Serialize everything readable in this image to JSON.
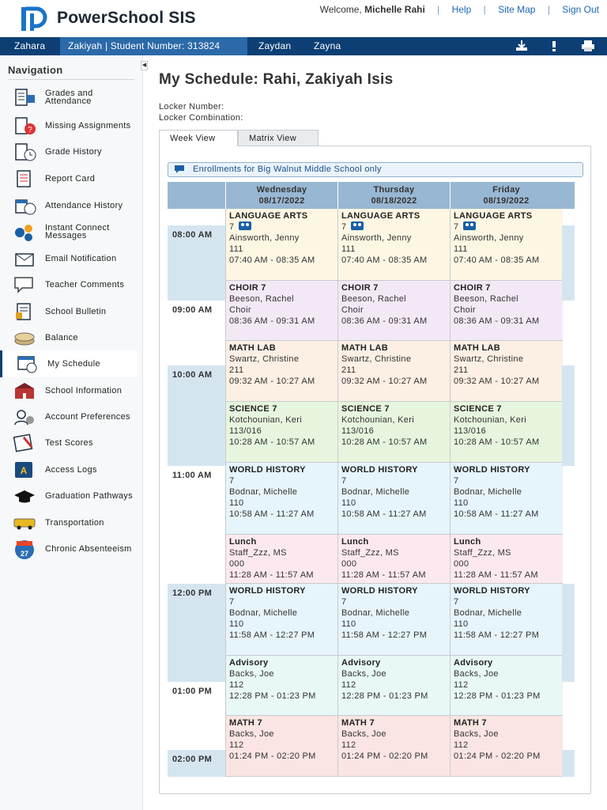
{
  "header": {
    "app_name": "PowerSchool SIS",
    "welcome_prefix": "Welcome,",
    "user_name": "Michelle Rahi",
    "links": [
      "Help",
      "Site Map",
      "Sign Out"
    ]
  },
  "student_tabs": [
    {
      "label": "Zahara",
      "active": false
    },
    {
      "label": "Zakiyah | Student Number: 313824",
      "active": true
    },
    {
      "label": "Zaydan",
      "active": false
    },
    {
      "label": "Zayna",
      "active": false
    }
  ],
  "toolbar_icons": [
    "download-icon",
    "alert-icon",
    "print-icon"
  ],
  "sidebar": {
    "title": "Navigation",
    "items": [
      {
        "label": "Grades and Attendance",
        "icon": "grades-attendance-icon"
      },
      {
        "label": "Missing Assignments",
        "icon": "missing-assignments-icon"
      },
      {
        "label": "Grade History",
        "icon": "grade-history-icon"
      },
      {
        "label": "Report Card",
        "icon": "report-card-icon"
      },
      {
        "label": "Attendance History",
        "icon": "attendance-history-icon"
      },
      {
        "label": "Instant Connect Messages",
        "icon": "instant-connect-icon"
      },
      {
        "label": "Email Notification",
        "icon": "email-icon"
      },
      {
        "label": "Teacher Comments",
        "icon": "teacher-comments-icon"
      },
      {
        "label": "School Bulletin",
        "icon": "bulletin-icon"
      },
      {
        "label": "Balance",
        "icon": "balance-icon"
      },
      {
        "label": "My Schedule",
        "icon": "schedule-icon",
        "active": true
      },
      {
        "label": "School Information",
        "icon": "school-icon"
      },
      {
        "label": "Account Preferences",
        "icon": "account-icon"
      },
      {
        "label": "Test Scores",
        "icon": "test-scores-icon"
      },
      {
        "label": "Access Logs",
        "icon": "access-logs-icon"
      },
      {
        "label": "Graduation Pathways",
        "icon": "graduation-icon"
      },
      {
        "label": "Transportation",
        "icon": "bus-icon"
      },
      {
        "label": "Chronic Absenteeism",
        "icon": "calendar-icon",
        "icon_text": "27"
      }
    ]
  },
  "page": {
    "title": "My Schedule: Rahi, Zakiyah Isis",
    "locker_number_label": "Locker Number:",
    "locker_combination_label": "Locker Combination:",
    "tabs": [
      {
        "label": "Week View",
        "active": true
      },
      {
        "label": "Matrix View",
        "active": false
      }
    ],
    "enrollment_note": "Enrollments for Big Walnut Middle School only"
  },
  "schedule": {
    "days": [
      {
        "name": "Wednesday",
        "date": "08/17/2022"
      },
      {
        "name": "Thursday",
        "date": "08/18/2022"
      },
      {
        "name": "Friday",
        "date": "08/19/2022"
      }
    ],
    "hours": [
      "08:00 AM",
      "09:00 AM",
      "10:00 AM",
      "11:00 AM",
      "12:00 PM",
      "01:00 PM",
      "02:00 PM"
    ],
    "classes": [
      {
        "name": "LANGUAGE ARTS",
        "section": "7",
        "group_icon": true,
        "teacher": "Ainsworth, Jenny",
        "room": "111",
        "time": "07:40 AM - 08:35 AM",
        "color": "#fdf6e3"
      },
      {
        "name": "CHOIR 7",
        "teacher": "Beeson, Rachel",
        "room": "Choir",
        "time": "08:36 AM - 09:31 AM",
        "color": "#f3e9f6"
      },
      {
        "name": "MATH LAB",
        "teacher": "Swartz, Christine",
        "room": "211",
        "time": "09:32 AM - 10:27 AM",
        "color": "#fcefe3"
      },
      {
        "name": "SCIENCE 7",
        "teacher": "Kotchounian, Keri",
        "room": "113/016",
        "time": "10:28 AM - 10:57 AM",
        "color": "#e6f5de"
      },
      {
        "name": "WORLD HISTORY",
        "section": "7",
        "teacher": "Bodnar, Michelle",
        "room": "110",
        "time": "10:58 AM - 11:27 AM",
        "color": "#e6f4fb"
      },
      {
        "name": "Lunch",
        "teacher": "Staff_Zzz, MS",
        "room": "000",
        "time": "11:28 AM - 11:57 AM",
        "color": "#fce9ef"
      },
      {
        "name": "WORLD HISTORY",
        "section": "7",
        "teacher": "Bodnar, Michelle",
        "room": "110",
        "time": "11:58 AM - 12:27 PM",
        "color": "#e6f4fb"
      },
      {
        "name": "Advisory",
        "teacher": "Backs, Joe",
        "room": "112",
        "time": "12:28 PM - 01:23 PM",
        "color": "#e8f8f4"
      },
      {
        "name": "MATH 7",
        "teacher": "Backs, Joe",
        "room": "112",
        "time": "01:24 PM - 02:20 PM",
        "color": "#fbe5e2"
      }
    ]
  },
  "colors": {
    "brand": "#0d3f74",
    "student_tab_active": "#2b69a8",
    "header_row": "#98b7d2",
    "hour_band": "#d5e5f0"
  }
}
